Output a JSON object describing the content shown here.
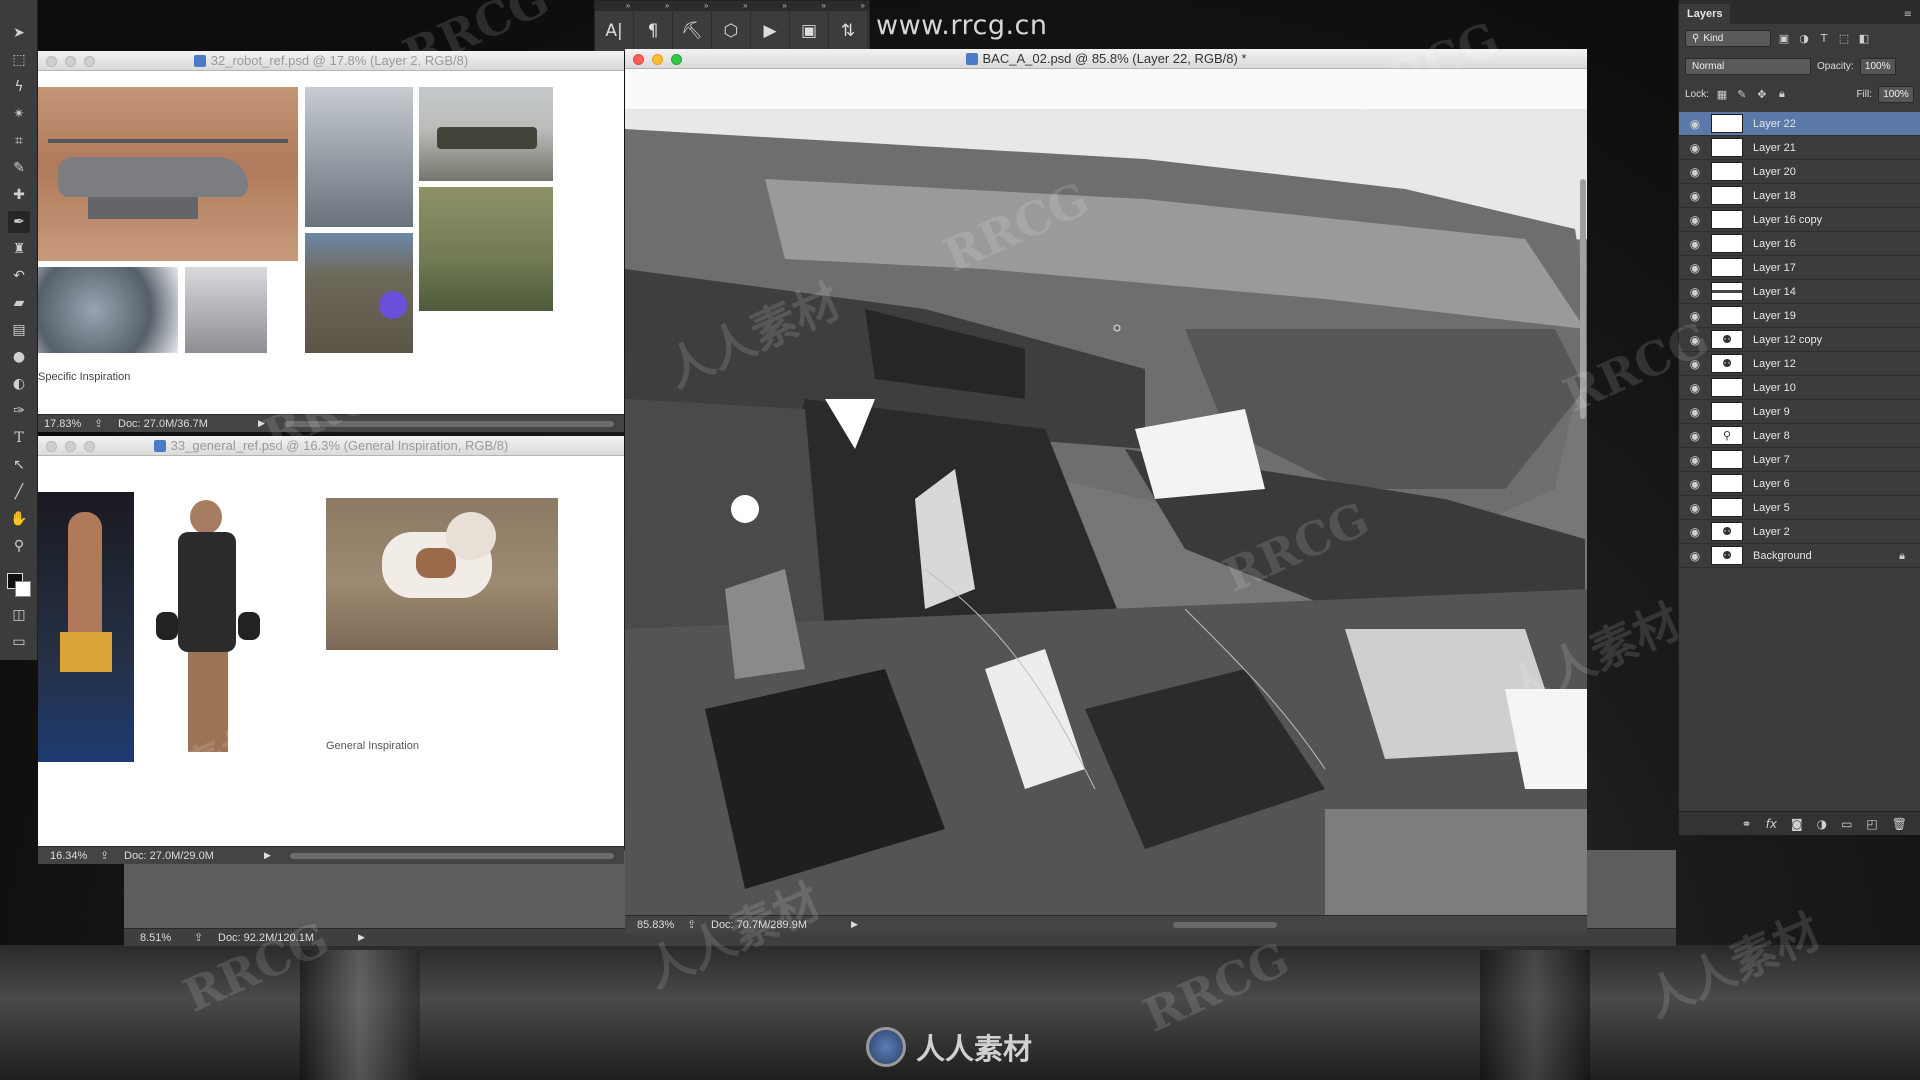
{
  "site_watermark_url": "www.rrcg.cn",
  "watermark_text": "RRCG",
  "watermark_text_cn": "人人素材",
  "bottom_logo_text": "人人素材",
  "top_palette": {
    "buttons": [
      "A|",
      "¶",
      "⛏",
      "⬡",
      "▶",
      "▣",
      "⇅"
    ]
  },
  "tools": [
    "move-tool-icon",
    "marquee-tool-icon",
    "lasso-tool-icon",
    "magic-wand-icon",
    "crop-tool-icon",
    "eyedropper-icon",
    "healing-brush-icon",
    "brush-tool-icon",
    "clone-stamp-icon",
    "history-brush-icon",
    "eraser-icon",
    "gradient-tool-icon",
    "blur-tool-icon",
    "dodge-tool-icon",
    "pen-tool-icon",
    "type-tool-icon",
    "path-select-icon",
    "line-tool-icon",
    "hand-tool-icon",
    "zoom-tool-icon"
  ],
  "windows": {
    "robot_ref": {
      "title": "32_robot_ref.psd @ 17.8% (Layer 2, RGB/8)",
      "caption": "Specific Inspiration",
      "zoom": "17.83%",
      "doc": "Doc: 27.0M/36.7M"
    },
    "general_ref": {
      "title": "33_general_ref.psd @ 16.3% (General Inspiration, RGB/8)",
      "caption": "General Inspiration",
      "zoom": "16.34%",
      "doc": "Doc: 27.0M/29.0M"
    },
    "back_doc": {
      "zoom": "8.51%",
      "doc": "Doc: 92.2M/120.1M"
    },
    "main": {
      "title": "BAC_A_02.psd @ 85.8% (Layer 22, RGB/8) *",
      "zoom": "85.83%",
      "doc": "Doc: 70.7M/289.9M"
    }
  },
  "layers_panel": {
    "tab": "Layers",
    "filter": "Kind",
    "blend_mode": "Normal",
    "opacity_label": "Opacity:",
    "opacity": "100%",
    "lock_label": "Lock:",
    "fill_label": "Fill:",
    "fill": "100%",
    "layers": [
      {
        "name": "Layer 22",
        "active": true
      },
      {
        "name": "Layer 21"
      },
      {
        "name": "Layer 20"
      },
      {
        "name": "Layer 18"
      },
      {
        "name": "Layer 16 copy"
      },
      {
        "name": "Layer 16"
      },
      {
        "name": "Layer 17"
      },
      {
        "name": "Layer 14"
      },
      {
        "name": "Layer 19"
      },
      {
        "name": "Layer 12 copy"
      },
      {
        "name": "Layer 12"
      },
      {
        "name": "Layer 10"
      },
      {
        "name": "Layer 9"
      },
      {
        "name": "Layer 8"
      },
      {
        "name": "Layer 7"
      },
      {
        "name": "Layer 6"
      },
      {
        "name": "Layer 5"
      },
      {
        "name": "Layer 2"
      },
      {
        "name": "Background",
        "locked": true
      }
    ]
  }
}
